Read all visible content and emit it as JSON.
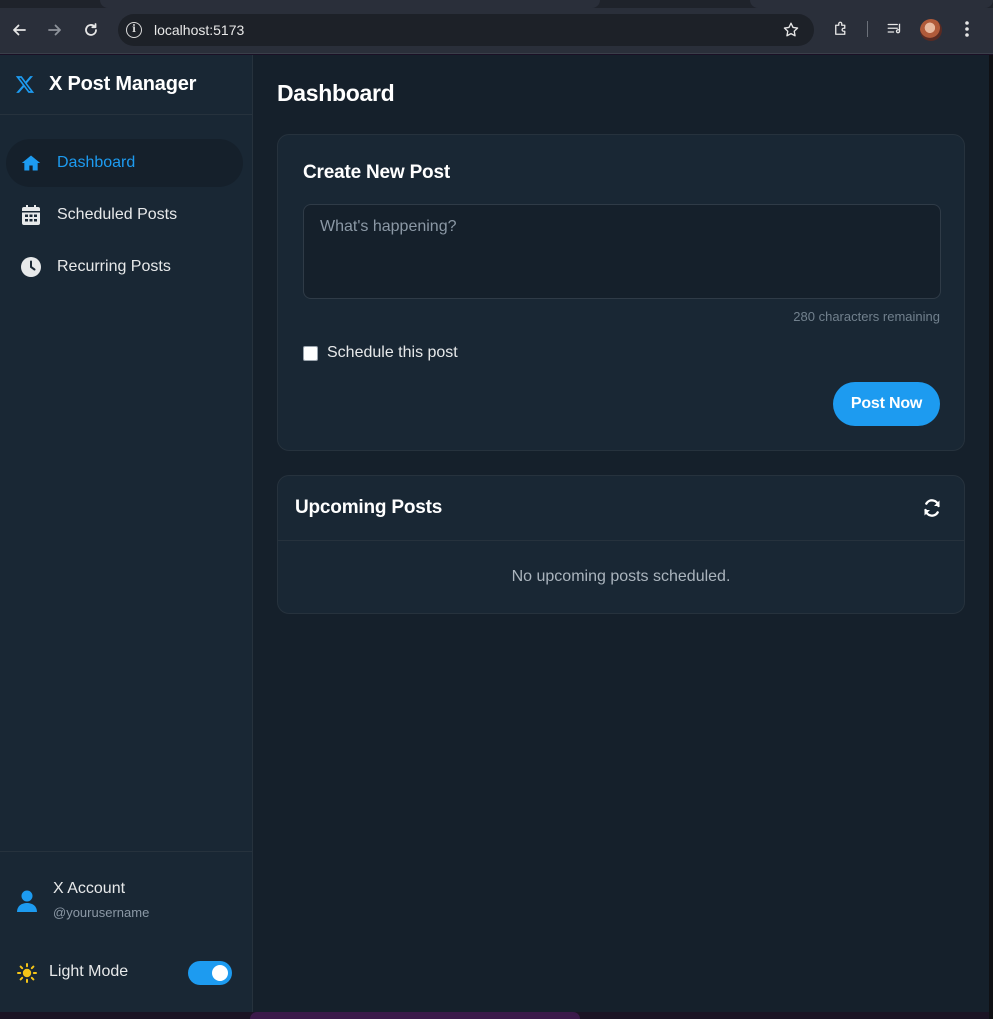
{
  "browser": {
    "url": "localhost:5173",
    "icons": [
      "back-icon",
      "forward-icon",
      "reload-icon",
      "site-info-icon",
      "bookmark-star-icon",
      "extensions-icon",
      "media-controls-icon",
      "profile-avatar",
      "menu-icon"
    ]
  },
  "app": {
    "name": "X Post Manager",
    "accent": "#1d9bf0"
  },
  "sidebar": {
    "items": [
      {
        "label": "Dashboard",
        "icon": "home-icon",
        "active": true
      },
      {
        "label": "Scheduled Posts",
        "icon": "calendar-icon",
        "active": false
      },
      {
        "label": "Recurring Posts",
        "icon": "clock-icon",
        "active": false
      }
    ],
    "account": {
      "name": "X Account",
      "handle": "@yourusername"
    },
    "theme": {
      "label": "Light Mode",
      "enabled": true
    }
  },
  "main": {
    "title": "Dashboard",
    "create": {
      "title": "Create New Post",
      "placeholder": "What's happening?",
      "value": "",
      "counter": "280 characters remaining",
      "schedule_label": "Schedule this post",
      "schedule_checked": false,
      "post_button": "Post Now"
    },
    "upcoming": {
      "title": "Upcoming Posts",
      "empty_text": "No upcoming posts scheduled."
    }
  }
}
